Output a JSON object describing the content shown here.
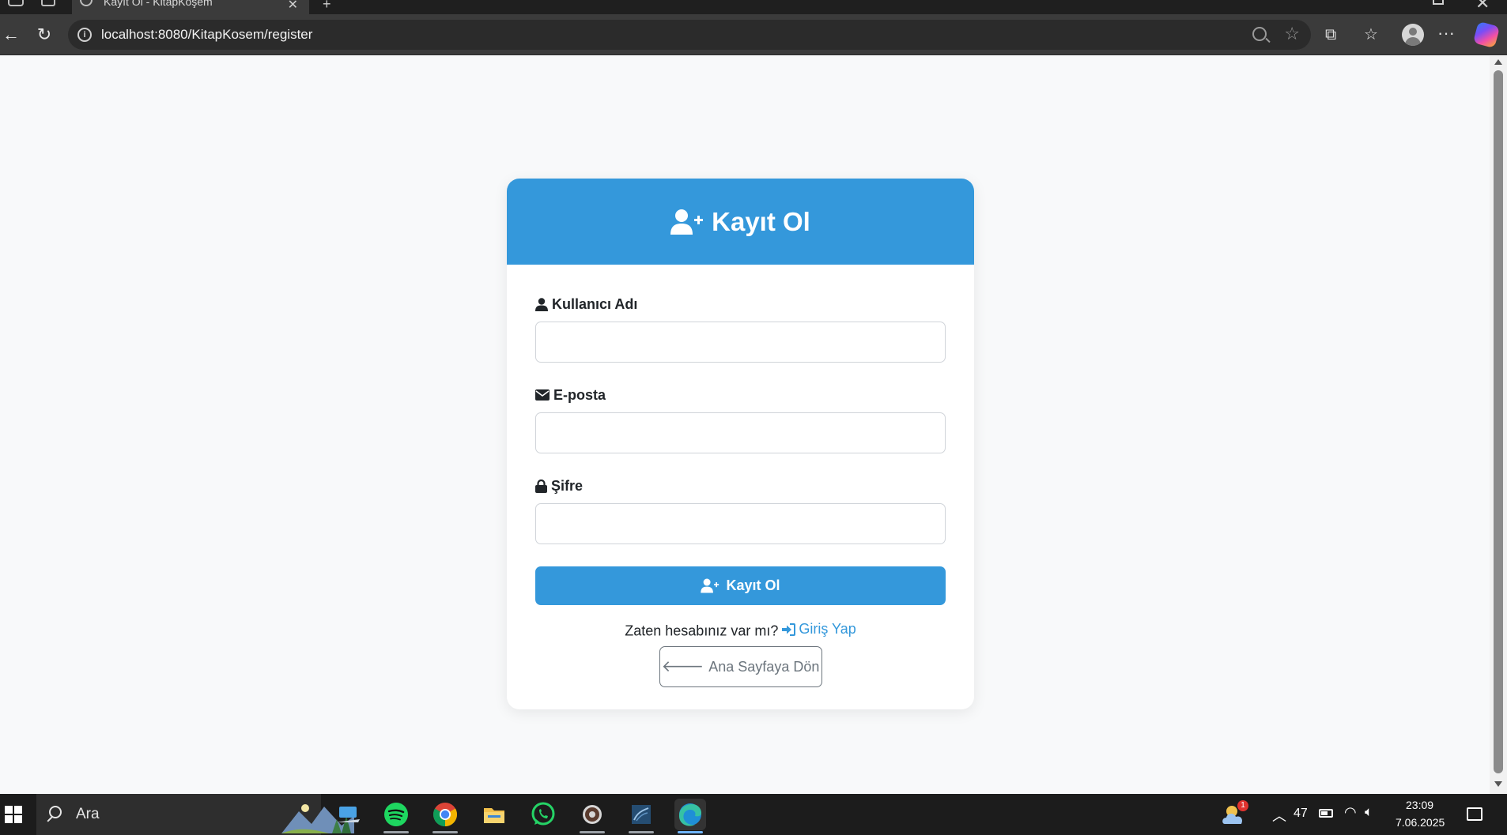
{
  "browser": {
    "tab_title": "Kayıt Ol - KitapKöşem",
    "url": "localhost:8080/KitapKosem/register"
  },
  "page": {
    "header_title": "Kayıt Ol",
    "fields": {
      "username_label": "Kullanıcı Adı",
      "username_value": "",
      "email_label": "E-posta",
      "email_value": "",
      "password_label": "Şifre",
      "password_value": ""
    },
    "submit_label": "Kayıt Ol",
    "login_prompt": "Zaten hesabınız var mı?",
    "login_link": "Giriş Yap",
    "home_button": "Ana Sayfaya Dön"
  },
  "taskbar": {
    "search_placeholder": "Ara",
    "weather_badge": "1",
    "battery_label": "47",
    "time": "23:09",
    "date": "7.06.2025"
  },
  "colors": {
    "primary": "#3498db",
    "secondary": "#6c757d",
    "background": "#f8f9fa"
  },
  "icons": {
    "header": "user-plus-icon",
    "username": "user-icon",
    "email": "envelope-icon",
    "password": "lock-icon",
    "login": "sign-in-icon",
    "home": "arrow-left-icon"
  }
}
